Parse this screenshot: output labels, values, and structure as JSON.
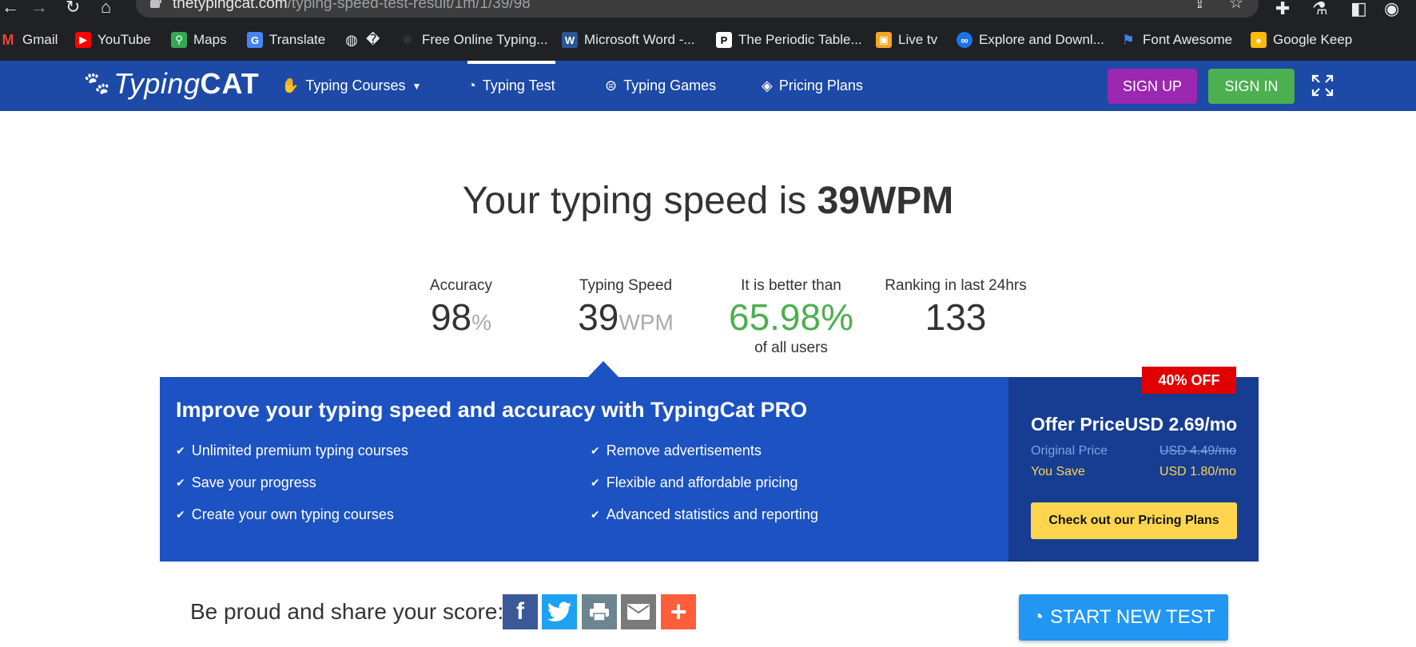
{
  "browser": {
    "url_host": "thetypingcat.com",
    "url_path": "/typing-speed-test-result/1m/1/39/98",
    "bookmarks": [
      {
        "label": "Gmail",
        "icon": "gmail-icon",
        "color": "#ea4335"
      },
      {
        "label": "YouTube",
        "icon": "youtube-icon",
        "color": "#ff0000"
      },
      {
        "label": "Maps",
        "icon": "maps-icon",
        "color": "#34a853"
      },
      {
        "label": "Translate",
        "icon": "translate-icon",
        "color": "#4285f4"
      },
      {
        "label": "�",
        "icon": "globe-icon",
        "color": "#e8eaed"
      },
      {
        "label": "Free Online Typing...",
        "icon": "typingcat-icon",
        "color": "#333333"
      },
      {
        "label": "Microsoft Word -...",
        "icon": "word-icon",
        "color": "#2b579a"
      },
      {
        "label": "The Periodic Table...",
        "icon": "periodic-table-icon",
        "color": "#ffffff"
      },
      {
        "label": "Live tv",
        "icon": "box-icon",
        "color": "#f5a623"
      },
      {
        "label": "Explore and Downl...",
        "icon": "infinity-icon",
        "color": "#1a73e8"
      },
      {
        "label": "Font Awesome",
        "icon": "flag-icon",
        "color": "#3b82f6"
      },
      {
        "label": "Google Keep",
        "icon": "keep-icon",
        "color": "#fbbc04"
      }
    ]
  },
  "nav": {
    "logo_typing": "Typing",
    "logo_cat": "CAT",
    "courses": "Typing Courses",
    "test": "Typing Test",
    "games": "Typing Games",
    "pricing": "Pricing Plans",
    "signup": "SIGN UP",
    "signin": "SIGN IN"
  },
  "result": {
    "headline_prefix": "Your typing speed is ",
    "headline_value": "39WPM",
    "stats": {
      "accuracy_label": "Accuracy",
      "accuracy_value": "98",
      "accuracy_unit": "%",
      "speed_label": "Typing Speed",
      "speed_value": "39",
      "speed_unit": "WPM",
      "better_label": "It is better than",
      "better_value": "65.98%",
      "better_sub": "of all users",
      "rank_label": "Ranking in last 24hrs",
      "rank_value": "133"
    }
  },
  "promo": {
    "title": "Improve your typing speed and accuracy with TypingCat PRO",
    "features_left": [
      "Unlimited premium typing courses",
      "Save your progress",
      "Create your own typing courses"
    ],
    "features_right": [
      "Remove advertisements",
      "Flexible and affordable pricing",
      "Advanced statistics and reporting"
    ],
    "badge": "40% OFF",
    "offer_label": "Offer Price",
    "offer_price": "USD 2.69/mo",
    "original_label": "Original Price",
    "original_price": "USD 4.49/mo",
    "save_label": "You Save",
    "save_value": "USD 1.80/mo",
    "cta": "Check out our Pricing Plans"
  },
  "share": {
    "label": "Be proud and share your score:",
    "new_test": "START NEW TEST"
  }
}
